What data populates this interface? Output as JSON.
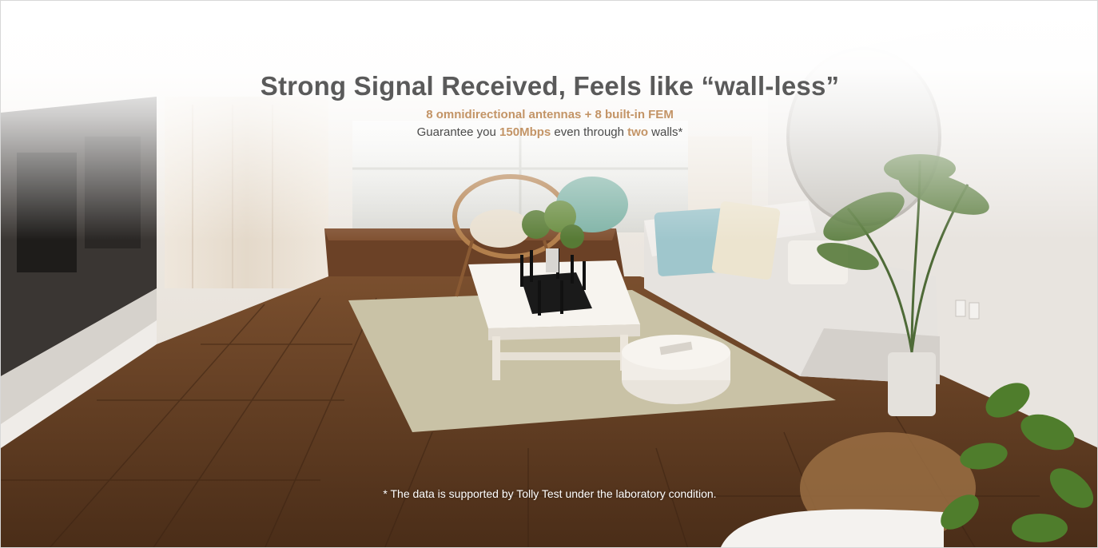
{
  "banner": {
    "headline": "Strong Signal Received, Feels like “wall-less”",
    "subheadline": "8 omnidirectional antennas + 8 built-in FEM",
    "guarantee": {
      "prefix": "Guarantee you",
      "speed": "150Mbps",
      "middle": "even through",
      "count": "two",
      "suffix": "walls*"
    },
    "footnote": "* The data is supported by Tolly Test under the laboratory condition."
  },
  "colors": {
    "headline": "#5a5a5a",
    "accent": "#c39466",
    "body_text": "#4a4a4a",
    "floor": "#5e3a20",
    "rug": "#c9c2a6",
    "sofa": "#e6e3df"
  }
}
